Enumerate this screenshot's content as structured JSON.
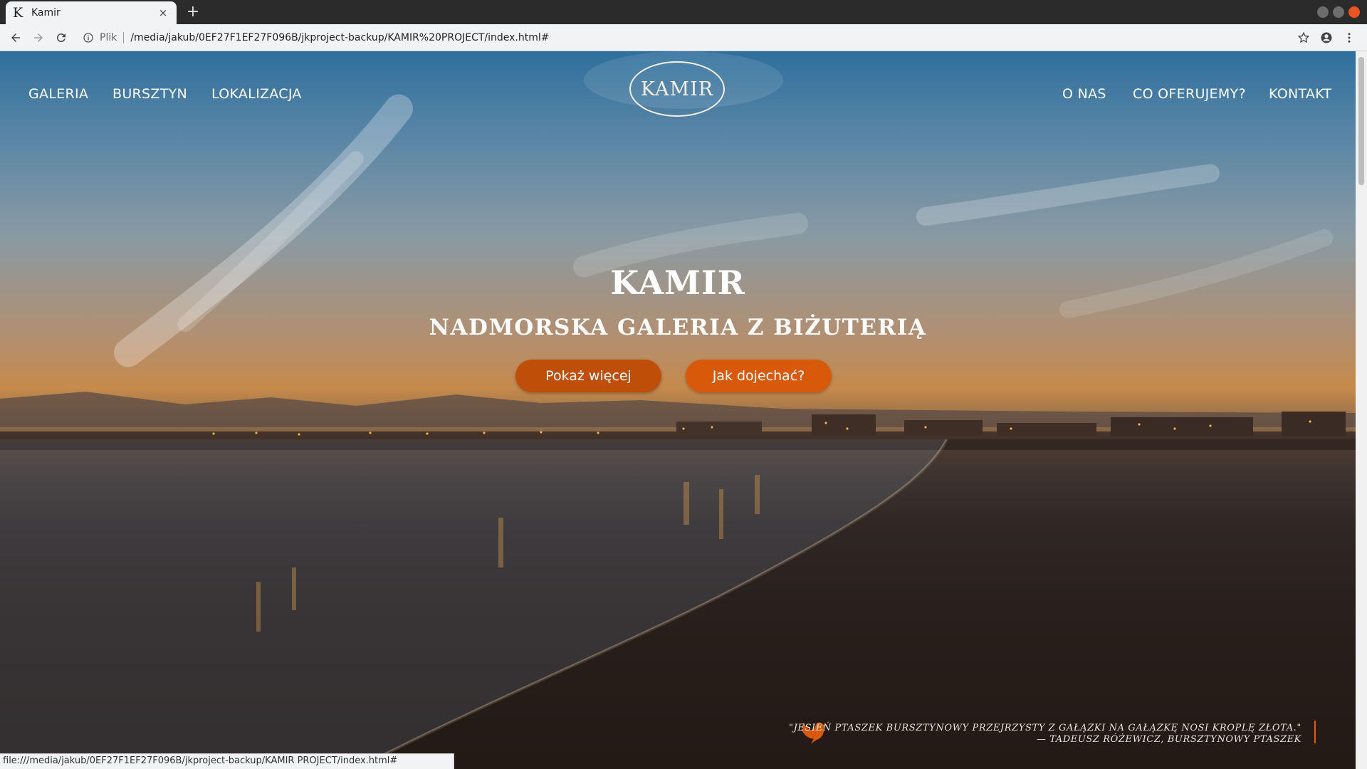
{
  "browser": {
    "tab_favicon": "K",
    "tab_title": "Kamir",
    "tab_close": "×",
    "new_tab": "+",
    "site_label": "Plik",
    "url": "/media/jakub/0EF27F1EF27F096B/jkproject-backup/KAMIR%20PROJECT/index.html#",
    "status_url": "file:///media/jakub/0EF27F1EF27F096B/jkproject-backup/KAMIR PROJECT/index.html#",
    "icons": [
      "back-arrow-icon",
      "forward-arrow-icon",
      "reload-icon",
      "info-icon",
      "star-icon",
      "account-icon",
      "menu-dots-icon"
    ]
  },
  "nav": {
    "left": [
      "GALERIA",
      "BURSZTYN",
      "LOKALIZACJA"
    ],
    "right": [
      "O NAS",
      "CO OFERUJEMY?",
      "KONTAKT"
    ],
    "logo": "KAMIR"
  },
  "hero": {
    "title": "KAMIR",
    "subtitle": "NADMORSKA GALERIA Z BIŻUTERIĄ",
    "buttons": [
      "Pokaż więcej",
      "Jak dojechać?"
    ]
  },
  "quote": {
    "line1": "\"JESIEŃ PTASZEK BURSZTYNOWY PRZEJRZYSTY Z GAŁĄZKI NA GAŁĄZKĘ NOSI KROPLĘ ZŁOTA.\"",
    "line2": "— TADEUSZ RÓŻEWICZ, BURSZTYNOWY PTASZEK",
    "icon": "bird-icon"
  },
  "colors": {
    "accent_dark": "#bf4e09",
    "accent": "#d9590b",
    "quote_bar": "#e65b10"
  }
}
